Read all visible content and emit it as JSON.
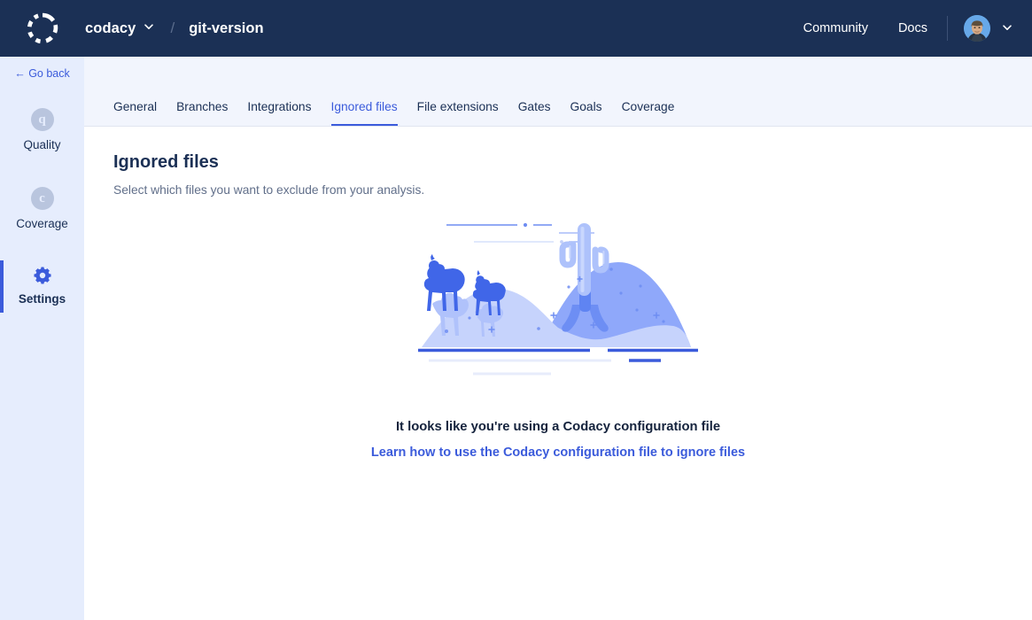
{
  "topbar": {
    "logo_icon": "codacy-logo-icon",
    "org": "codacy",
    "org_chevron_icon": "chevron-down-icon",
    "separator": "/",
    "repo": "git-version",
    "community_label": "Community",
    "docs_label": "Docs",
    "avatar_icon": "user-avatar",
    "avatar_chevron_icon": "chevron-down-icon"
  },
  "sidebar": {
    "go_back": "← Go back",
    "items": [
      {
        "label": "Quality",
        "badge": "q",
        "icon": "quality-badge-icon",
        "active": false
      },
      {
        "label": "Coverage",
        "badge": "c",
        "icon": "coverage-badge-icon",
        "active": false
      },
      {
        "label": "Settings",
        "badge": "",
        "icon": "gear-icon",
        "active": true
      }
    ]
  },
  "tabs": [
    {
      "label": "General",
      "active": false
    },
    {
      "label": "Branches",
      "active": false
    },
    {
      "label": "Integrations",
      "active": false
    },
    {
      "label": "Ignored files",
      "active": true
    },
    {
      "label": "File extensions",
      "active": false
    },
    {
      "label": "Gates",
      "active": false
    },
    {
      "label": "Goals",
      "active": false
    },
    {
      "label": "Coverage",
      "active": false
    }
  ],
  "main": {
    "title": "Ignored files",
    "subtitle": "Select which files you want to exclude from your analysis.",
    "empty_state": {
      "illustration": "desert-camels-cactus-illustration",
      "title": "It looks like you're using a Codacy configuration file",
      "link_label": "Learn how to use the Codacy configuration file to ignore files"
    }
  },
  "colors": {
    "header_navy": "#1b3055",
    "sidebar_bg": "#e6edfd",
    "tabstrip_bg": "#f2f5fd",
    "accent_blue": "#3b5bdb",
    "illustration_dark_dune": "#8fa8fa",
    "illustration_light_dune": "#c6d3fc",
    "illustration_camel": "#4066e8"
  }
}
